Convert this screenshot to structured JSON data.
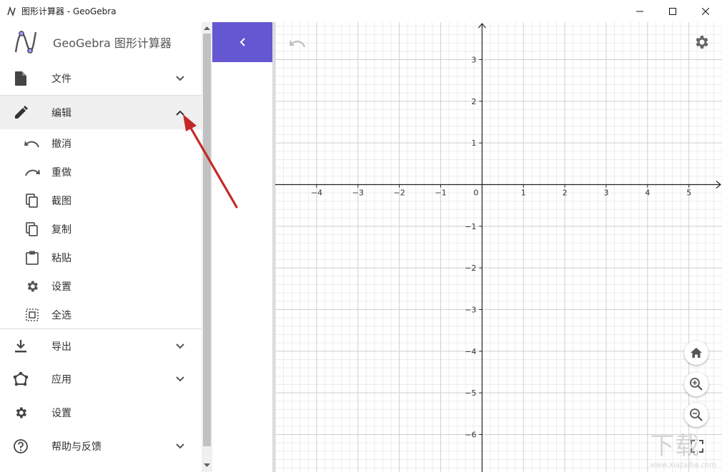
{
  "window": {
    "title": "图形计算器 - GeoGebra"
  },
  "menu": {
    "brand": "GeoGebra 图形计算器",
    "items": [
      {
        "label": "文件",
        "icon": "file-icon",
        "expanded": false
      },
      {
        "label": "编辑",
        "icon": "pencil-icon",
        "expanded": true
      },
      {
        "label": "导出",
        "icon": "download-icon",
        "expanded": false
      },
      {
        "label": "应用",
        "icon": "apps-icon",
        "expanded": false
      },
      {
        "label": "设置",
        "icon": "gear-icon",
        "expanded": false
      },
      {
        "label": "帮助与反馈",
        "icon": "help-icon",
        "expanded": false
      }
    ],
    "edit_submenu": [
      {
        "label": "撤消",
        "icon": "undo-icon"
      },
      {
        "label": "重做",
        "icon": "redo-icon"
      },
      {
        "label": "截图",
        "icon": "copy-image-icon"
      },
      {
        "label": "复制",
        "icon": "copy-icon"
      },
      {
        "label": "粘贴",
        "icon": "paste-icon"
      },
      {
        "label": "设置",
        "icon": "gear-icon"
      },
      {
        "label": "全选",
        "icon": "select-all-icon"
      }
    ]
  },
  "graph": {
    "x_ticks": [
      "−4",
      "−3",
      "−2",
      "−1",
      "0",
      "1",
      "2",
      "3",
      "4",
      "5"
    ],
    "y_ticks": [
      "3",
      "2",
      "1",
      "−1",
      "−2",
      "−3",
      "−4",
      "−5",
      "−6"
    ],
    "x_range": [
      -5,
      5.8
    ],
    "y_range": [
      -6.9,
      3.9
    ]
  },
  "colors": {
    "accent": "#6557d2",
    "annotation_arrow": "#d0312d",
    "active_row": "#f0f0f0"
  },
  "watermark": {
    "text": "下载",
    "sub": "www.xiazaiba.com"
  }
}
